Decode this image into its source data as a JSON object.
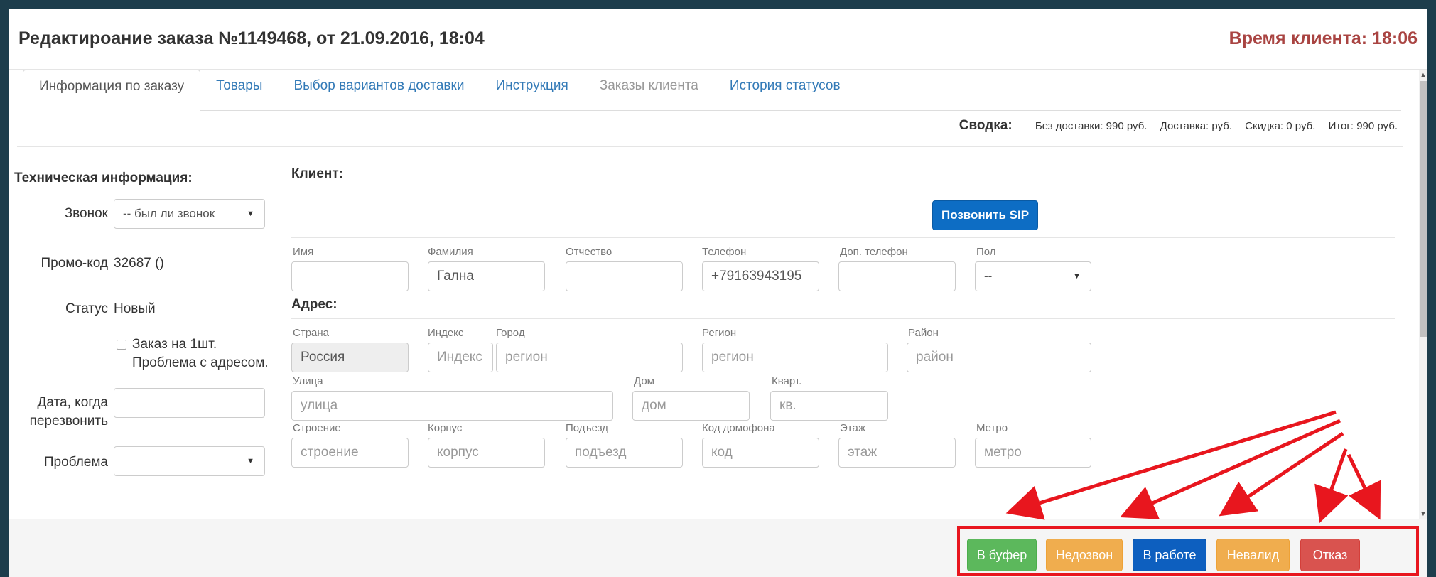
{
  "header": {
    "title": "Редактироание заказа №1149468, от 21.09.2016, 18:04",
    "client_time": "Время клиента: 18:06"
  },
  "tabs": [
    {
      "label": "Информация по заказу",
      "state": "active"
    },
    {
      "label": "Товары",
      "state": "link"
    },
    {
      "label": "Выбор вариантов доставки",
      "state": "link"
    },
    {
      "label": "Инструкция",
      "state": "link"
    },
    {
      "label": "Заказы клиента",
      "state": "disabled"
    },
    {
      "label": "История статусов",
      "state": "link"
    }
  ],
  "summary": {
    "label": "Сводка:",
    "no_delivery": "Без доставки: 990 руб.",
    "delivery": "Доставка: руб.",
    "discount": "Скидка: 0 руб.",
    "total": "Итог: 990 руб."
  },
  "tech": {
    "heading": "Техническая информация:",
    "call_label": "Звонок",
    "call_value": "-- был ли звонок",
    "promo_label": "Промо-код",
    "promo_value": "32687 ()",
    "status_label": "Статус",
    "status_value": "Новый",
    "checkbox_label": "Заказ на 1шт. Проблема с адресом.",
    "callback_label": "Дата, когда перезвонить",
    "callback_value": "",
    "problem_label": "Проблема",
    "problem_value": ""
  },
  "client": {
    "heading": "Клиент:",
    "sip_button": "Позвонить SIP",
    "first_name_label": "Имя",
    "first_name_value": "",
    "last_name_label": "Фамилия",
    "last_name_value": "Гална",
    "patronymic_label": "Отчество",
    "patronymic_value": "",
    "phone_label": "Телефон",
    "phone_value": "+79163943195",
    "extra_phone_label": "Доп. телефон",
    "extra_phone_value": "",
    "gender_label": "Пол",
    "gender_value": "--"
  },
  "address": {
    "heading": "Адрес:",
    "country_label": "Страна",
    "country_value": "Россия",
    "index_label": "Индекс",
    "index_placeholder": "Индекс",
    "city_label": "Город",
    "city_placeholder": "регион",
    "region_label": "Регион",
    "region_placeholder": "регион",
    "district_label": "Район",
    "district_placeholder": "район",
    "street_label": "Улица",
    "street_placeholder": "улица",
    "house_label": "Дом",
    "house_placeholder": "дом",
    "apt_label": "Кварт.",
    "apt_placeholder": "кв.",
    "building_label": "Строение",
    "building_placeholder": "строение",
    "corpus_label": "Корпус",
    "corpus_placeholder": "корпус",
    "entrance_label": "Подъезд",
    "entrance_placeholder": "подъезд",
    "intercom_label": "Код домофона",
    "intercom_placeholder": "код",
    "floor_label": "Этаж",
    "floor_placeholder": "этаж",
    "metro_label": "Метро",
    "metro_placeholder": "метро"
  },
  "footer": {
    "buffer": "В буфер",
    "no_answer": "Недозвон",
    "in_work": "В работе",
    "invalid": "Невалид",
    "reject": "Отказ"
  },
  "colors": {
    "annotation": "#e8161e",
    "client_time": "#a94442",
    "link": "#337ab7",
    "primary": "#0d6dc4",
    "success": "#5cb85c",
    "warning": "#f0ad4e",
    "danger": "#d9534f"
  }
}
